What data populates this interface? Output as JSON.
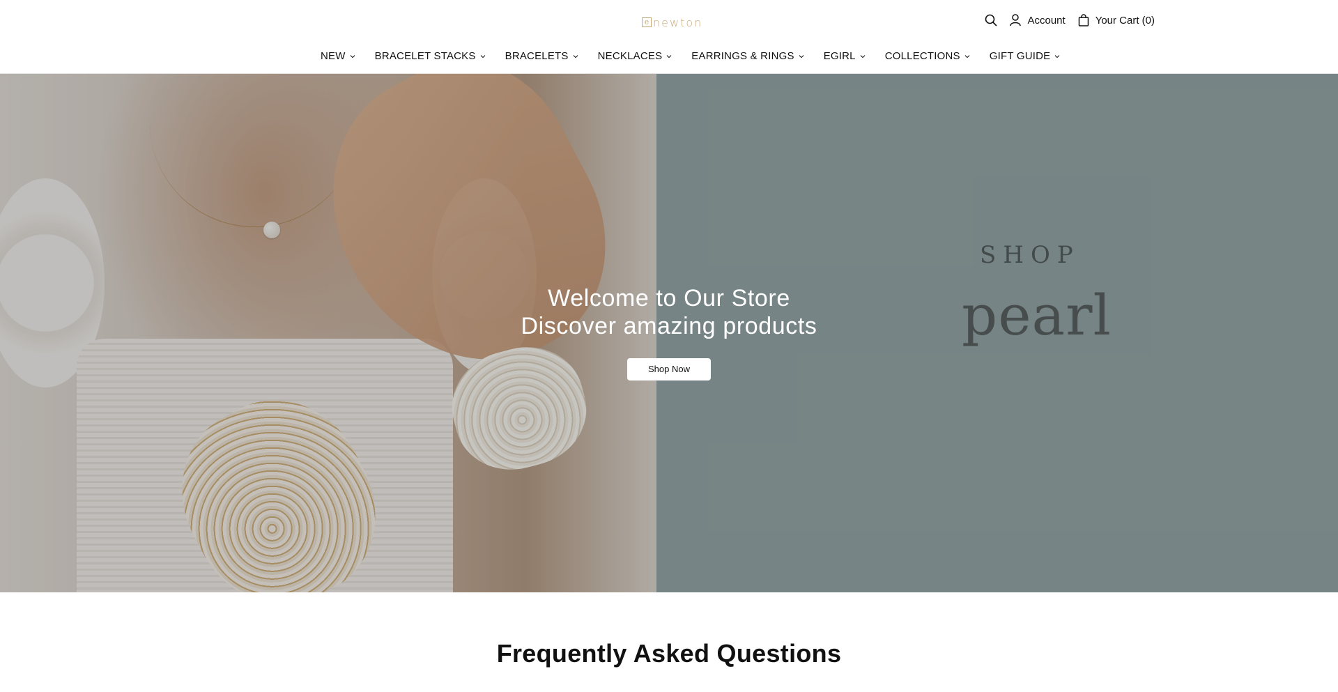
{
  "header": {
    "logo_text": "newton",
    "logo_mark": "e",
    "search_icon": "search-icon",
    "account_label": "Account",
    "cart_label": "Your Cart (0)"
  },
  "nav": {
    "items": [
      {
        "label": "NEW"
      },
      {
        "label": "BRACELET STACKS"
      },
      {
        "label": "BRACELETS"
      },
      {
        "label": "NECKLACES"
      },
      {
        "label": "EARRINGS & RINGS"
      },
      {
        "label": "EGIRL"
      },
      {
        "label": "COLLECTIONS"
      },
      {
        "label": "GIFT GUIDE"
      }
    ]
  },
  "hero": {
    "panel_shop": "SHOP",
    "panel_pearl": "pearl",
    "title_line1": "Welcome to Our Store",
    "title_line2": "Discover amazing products",
    "cta_label": "Shop Now",
    "panel_color": "#99aaab"
  },
  "faq": {
    "title": "Frequently Asked Questions"
  }
}
